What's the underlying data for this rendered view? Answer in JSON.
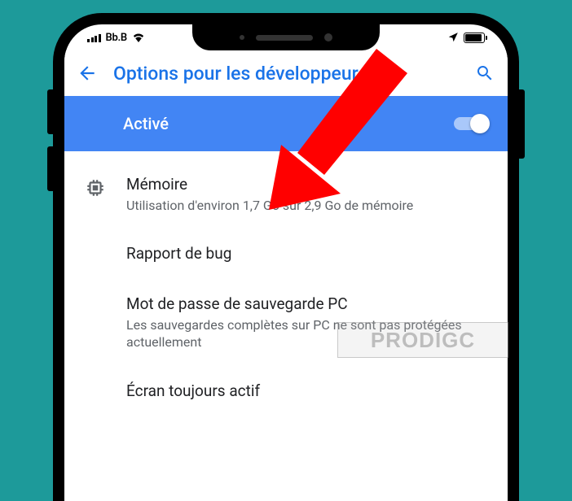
{
  "statusbar": {
    "carrier": "Bb.B"
  },
  "appbar": {
    "title": "Options pour les développeurs"
  },
  "master_toggle": {
    "label": "Activé",
    "on": true
  },
  "items": [
    {
      "icon": "memory",
      "primary": "Mémoire",
      "secondary": "Utilisation d'environ 1,7 Go sur 2,9 Go de mémoire"
    },
    {
      "icon": null,
      "primary": "Rapport de bug",
      "secondary": ""
    },
    {
      "icon": null,
      "primary": "Mot de passe de sauvegarde PC",
      "secondary": "Les sauvegardes complètes sur PC ne sont pas protégées actuellement"
    },
    {
      "icon": null,
      "primary": "Écran toujours actif",
      "secondary": ""
    }
  ],
  "watermark": {
    "text": "PRODIGC"
  },
  "accent": "#4285f4"
}
